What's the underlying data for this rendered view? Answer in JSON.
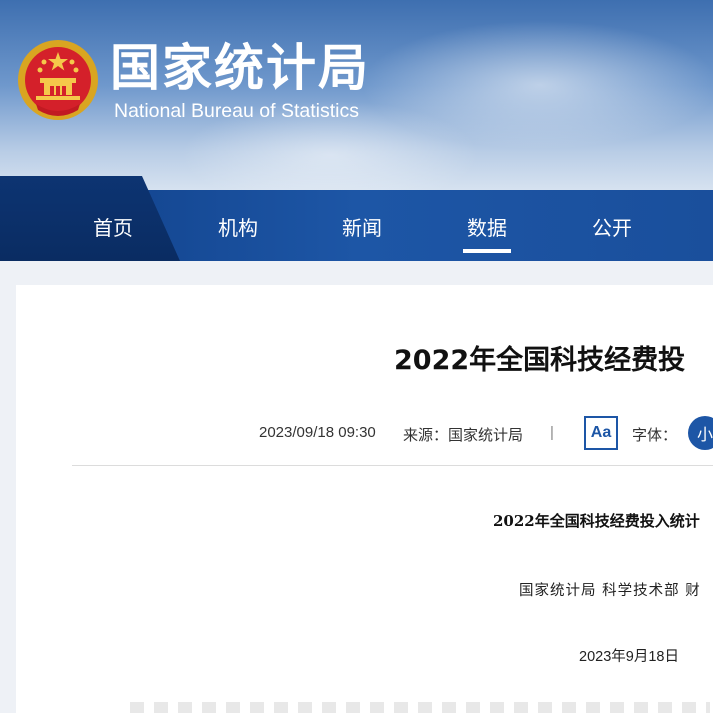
{
  "header": {
    "site_name_cn": "国家统计局",
    "site_name_en": "National Bureau of Statistics",
    "emblem_icon": "national-emblem-icon"
  },
  "nav": {
    "items": [
      {
        "label": "首页"
      },
      {
        "label": "机构"
      },
      {
        "label": "新闻"
      },
      {
        "label": "数据",
        "active": true
      },
      {
        "label": "公开"
      }
    ]
  },
  "article": {
    "title": "2022年全国科技经费投",
    "date": "2023/09/18 09:30",
    "source": "来源：国家统计局",
    "separator": "|",
    "font_button": "Aa",
    "font_label": "字体：",
    "font_size_small": "小"
  },
  "document": {
    "title": "2022年全国科技经费投入统计",
    "issuer": "国家统计局 科学技术部 财",
    "date": "2023年9月18日"
  },
  "colors": {
    "nav_bg": "#1d56a6",
    "accent": "#1d56a6",
    "text": "#111111"
  }
}
